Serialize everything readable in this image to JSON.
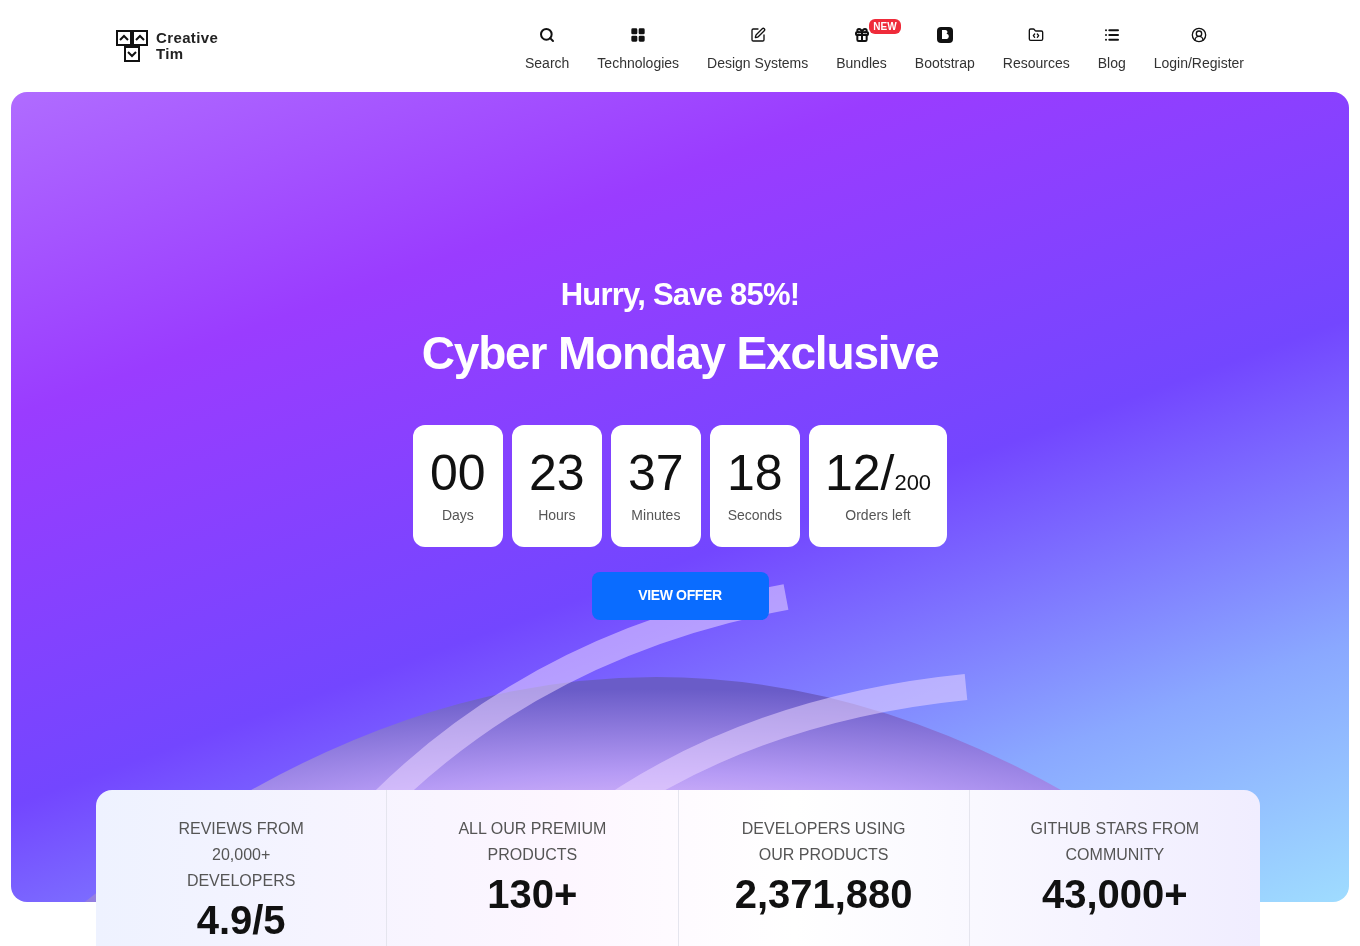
{
  "brand": {
    "line1": "Creative",
    "line2": "Tim"
  },
  "nav": [
    {
      "label": "Search"
    },
    {
      "label": "Technologies"
    },
    {
      "label": "Design Systems"
    },
    {
      "label": "Bundles",
      "badge": "NEW"
    },
    {
      "label": "Bootstrap"
    },
    {
      "label": "Resources"
    },
    {
      "label": "Blog"
    },
    {
      "label": "Login/Register"
    }
  ],
  "hero": {
    "subtitle": "Hurry, Save 85%!",
    "title": "Cyber Monday Exclusive",
    "countdown": [
      {
        "value": "00",
        "label": "Days"
      },
      {
        "value": "23",
        "label": "Hours"
      },
      {
        "value": "37",
        "label": "Minutes"
      },
      {
        "value": "18",
        "label": "Seconds"
      },
      {
        "value": "12/",
        "total": "200",
        "label": "Orders left"
      }
    ],
    "button": "VIEW OFFER"
  },
  "stats": [
    {
      "label": "REVIEWS FROM 20,000+ DEVELOPERS",
      "value": "4.9/5"
    },
    {
      "label": "ALL OUR PREMIUM PRODUCTS",
      "value": "130+"
    },
    {
      "label": "DEVELOPERS USING OUR PRODUCTS",
      "value": "2,371,880"
    },
    {
      "label": "GITHUB STARS FROM COMMUNITY",
      "value": "43,000+"
    }
  ]
}
